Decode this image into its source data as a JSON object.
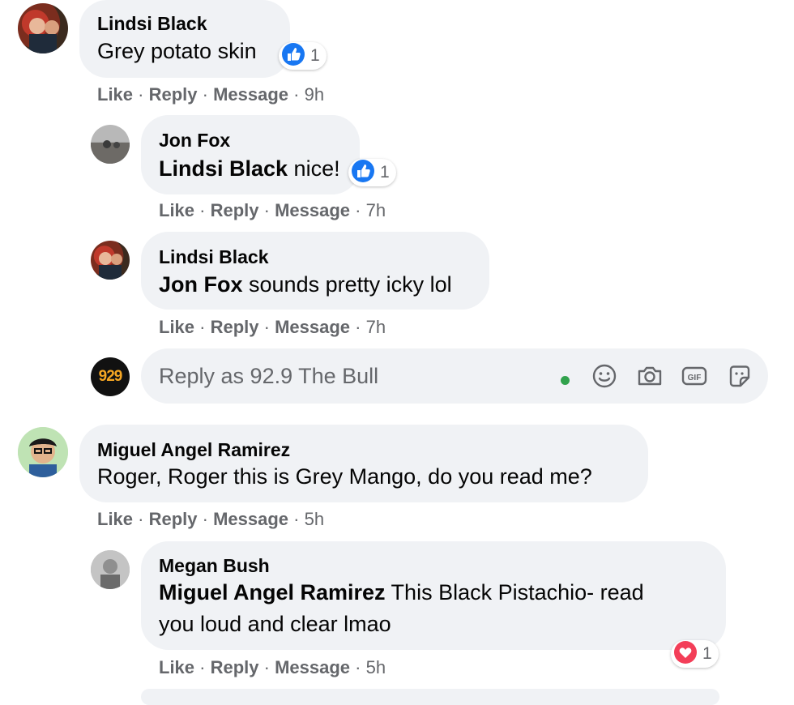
{
  "comments": [
    {
      "author": "Lindsi Black",
      "text": "Grey potato skin",
      "reaction_count": "1",
      "actions": {
        "like": "Like",
        "reply": "Reply",
        "message": "Message",
        "time": "9h"
      }
    },
    {
      "author": "Jon Fox",
      "mention": "Lindsi Black",
      "text": " nice!",
      "reaction_count": "1",
      "actions": {
        "like": "Like",
        "reply": "Reply",
        "message": "Message",
        "time": "7h"
      }
    },
    {
      "author": "Lindsi Black",
      "mention": "Jon Fox",
      "text": " sounds pretty icky lol",
      "actions": {
        "like": "Like",
        "reply": "Reply",
        "message": "Message",
        "time": "7h"
      }
    },
    {
      "author": "Miguel Angel Ramirez",
      "text": "Roger, Roger this is Grey Mango, do you read me?",
      "actions": {
        "like": "Like",
        "reply": "Reply",
        "message": "Message",
        "time": "5h"
      }
    },
    {
      "author": "Megan Bush",
      "mention": "Miguel Angel Ramirez",
      "text": " This Black Pistachio- read",
      "text_line2": "you loud and clear lmao",
      "reaction_count": "1",
      "actions": {
        "like": "Like",
        "reply": "Reply",
        "message": "Message",
        "time": "5h"
      }
    }
  ],
  "reply_box": {
    "placeholder": "Reply as 92.9 The Bull",
    "avatar_text": "929"
  },
  "icons": {
    "like_reaction": "thumbs-up-icon",
    "love_reaction": "heart-icon",
    "emoji": "smiley-icon",
    "camera": "camera-icon",
    "gif": "gif-icon",
    "sticker": "sticker-icon",
    "online": "online-dot"
  },
  "colors": {
    "like_blue": "#1877f2",
    "love_red": "#f33e58",
    "online_green": "#31a24c",
    "bubble": "#f0f2f5",
    "meta_grey": "#65676b"
  }
}
